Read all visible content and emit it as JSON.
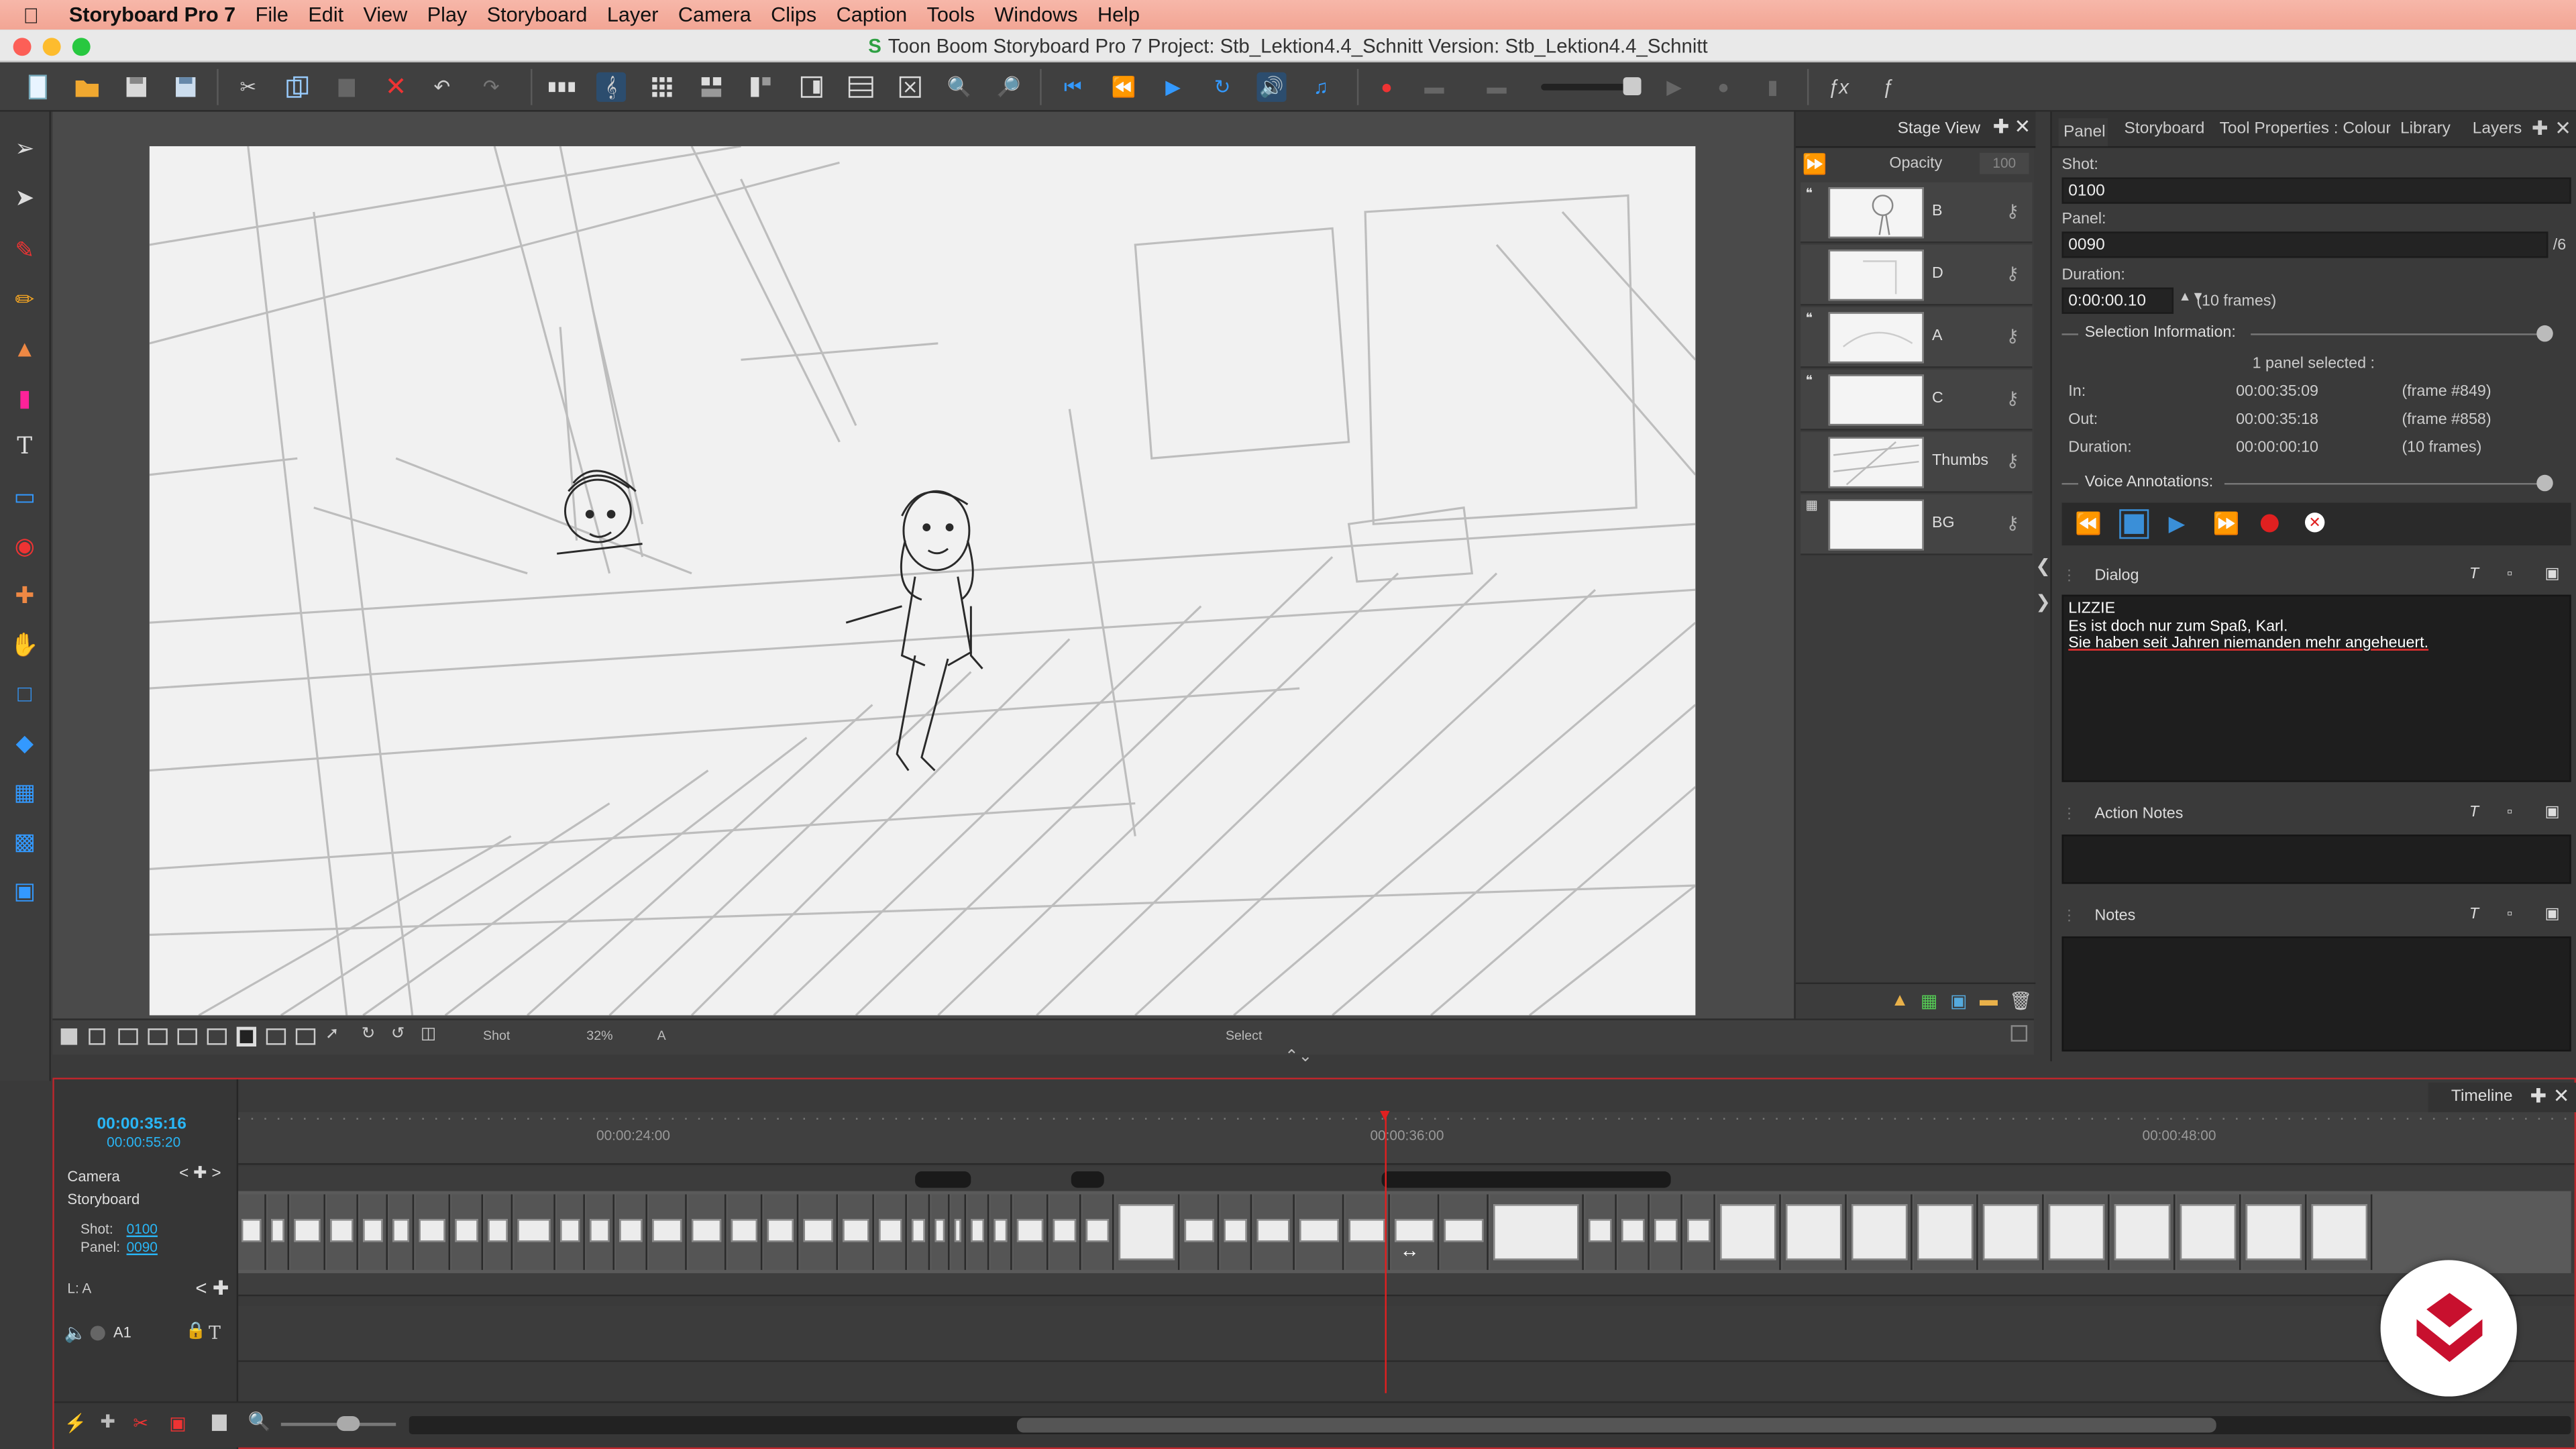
{
  "menubar": {
    "app_name": "Storyboard Pro 7",
    "items": [
      "File",
      "Edit",
      "View",
      "Play",
      "Storyboard",
      "Layer",
      "Camera",
      "Clips",
      "Caption",
      "Tools",
      "Windows",
      "Help"
    ]
  },
  "window": {
    "title": "Toon Boom Storyboard Pro 7 Project: Stb_Lektion4.4_Schnitt Version: Stb_Lektion4.4_Schnitt"
  },
  "stage_view": {
    "tab_label": "Stage View",
    "opacity_label": "Opacity",
    "opacity_value": "100",
    "status_shot": "Shot",
    "status_zoom": "32%",
    "status_layer": "A",
    "status_tool": "Select"
  },
  "layers": [
    {
      "name": "B"
    },
    {
      "name": "D"
    },
    {
      "name": "A"
    },
    {
      "name": "C"
    },
    {
      "name": "Thumbs"
    },
    {
      "name": "BG"
    }
  ],
  "panel_props": {
    "tabs": [
      "Panel",
      "Storyboard",
      "Tool Properties : Colour",
      "Library",
      "Layers"
    ],
    "shot_label": "Shot:",
    "shot_value": "0100",
    "panel_label": "Panel:",
    "panel_value": "0090",
    "panel_total": "/6",
    "duration_label": "Duration:",
    "duration_value": "0:00:00.10",
    "duration_frames": "(10 frames)",
    "selection_title": "Selection Information:",
    "selection_summary": "1 panel selected :",
    "in_label": "In:",
    "in_time": "00:00:35:09",
    "in_frame": "(frame #849)",
    "out_label": "Out:",
    "out_time": "00:00:35:18",
    "out_frame": "(frame #858)",
    "sel_duration_label": "Duration:",
    "sel_duration_time": "00:00:00:10",
    "sel_duration_frames": "(10 frames)",
    "voice_title": "Voice Annotations:",
    "dialog_title": "Dialog",
    "dialog_line1": "LIZZIE",
    "dialog_line2": "Es ist doch nur zum Spaß, Karl.",
    "dialog_line3": "Sie haben seit Jahren niemanden mehr angeheuert.",
    "action_title": "Action Notes",
    "notes_title": "Notes"
  },
  "timeline": {
    "tab_label": "Timeline",
    "current_time": "00:00:35:16",
    "total_time": "00:00:55:20",
    "ruler_marks": [
      "00:00:24:00",
      "00:00:36:00",
      "00:00:48:00"
    ],
    "track_camera": "Camera",
    "track_storyboard": "Storyboard",
    "shot_label": "Shot:",
    "shot_value": "0100",
    "panel_label": "Panel:",
    "panel_value": "0090",
    "layer_label": "L: A",
    "audio_track": "A1"
  },
  "colors": {
    "menubar_bg": "#f2a594",
    "accent_blue": "#3a8fd8",
    "timeline_border": "#c0262c",
    "playhead": "#e02020",
    "logo_red": "#c8102e",
    "timecode": "#29b6f6"
  }
}
